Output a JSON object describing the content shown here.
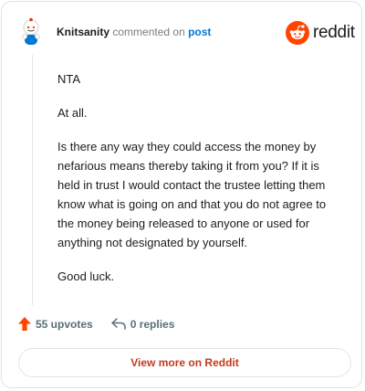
{
  "comment": {
    "author": "Knitsanity",
    "action_text": "commented on",
    "post_link": "post",
    "paragraphs": [
      "NTA",
      "At all.",
      "Is there any way they could access the money by nefarious means thereby taking it from you? If it is held in trust I would contact the trustee letting them know what is going on and that you do not agree to the money being released to anyone or used for anything not designated by yourself.",
      "Good luck."
    ]
  },
  "brand": {
    "name": "reddit",
    "color": "#ff4500"
  },
  "footer": {
    "upvotes_label": "55 upvotes",
    "replies_label": "0 replies",
    "upvote_color": "#ff4500"
  },
  "view_more_label": "View more on Reddit"
}
